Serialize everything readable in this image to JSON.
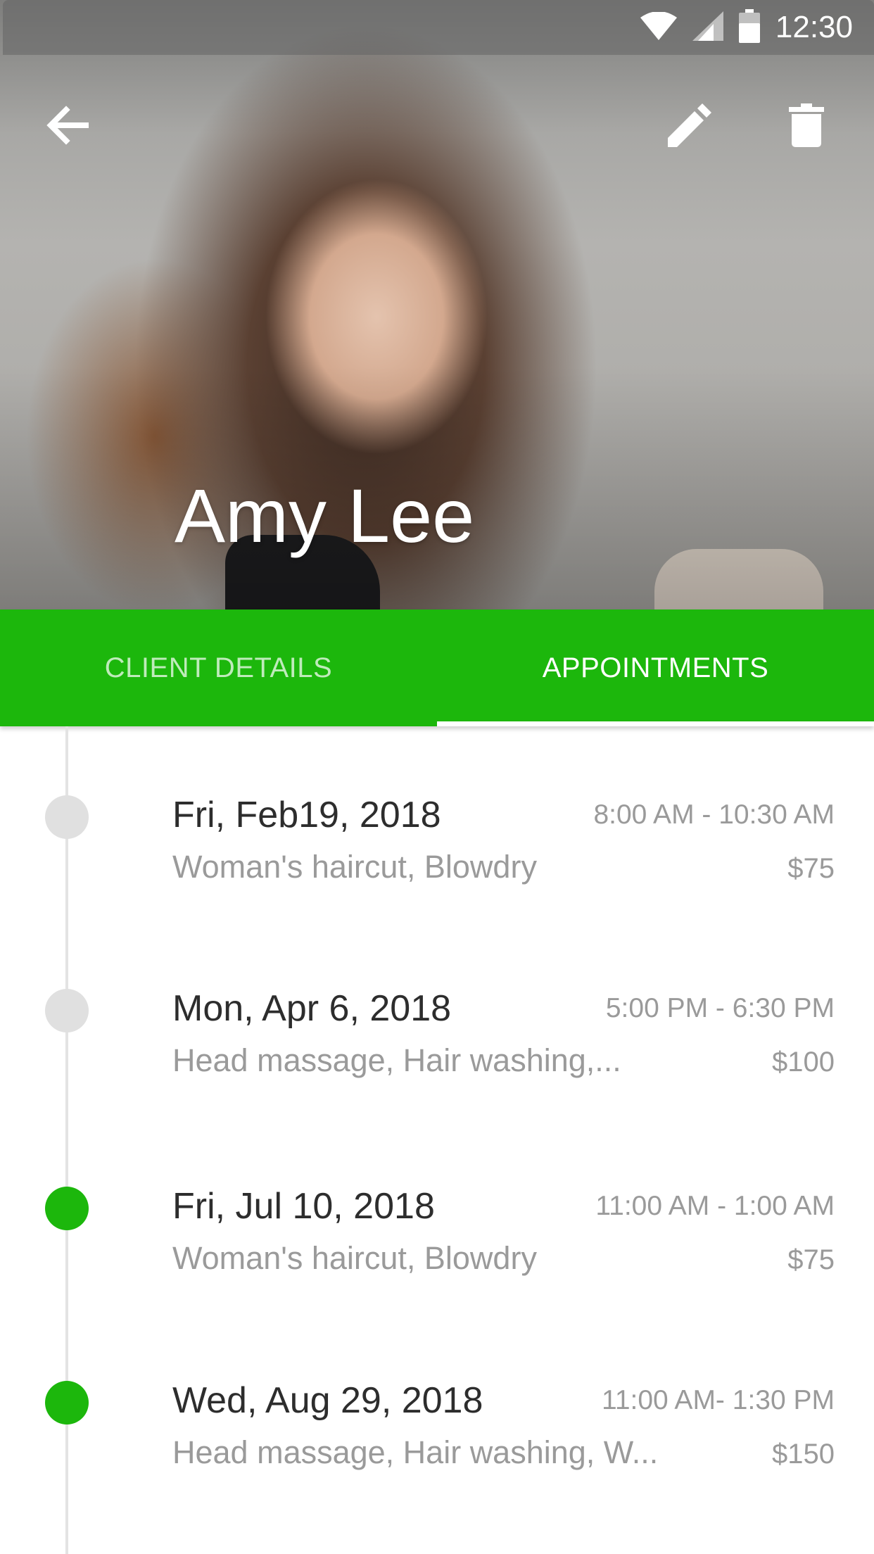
{
  "status_bar": {
    "time": "12:30",
    "icons": [
      "wifi-icon",
      "cell-signal-icon",
      "battery-icon"
    ]
  },
  "toolbar": {
    "back_icon": "arrow-left-icon",
    "edit_icon": "pencil-icon",
    "delete_icon": "trash-icon"
  },
  "client": {
    "name": "Amy Lee"
  },
  "tabs": [
    {
      "label": "CLIENT DETAILS",
      "active": false
    },
    {
      "label": "APPOINTMENTS",
      "active": true
    }
  ],
  "colors": {
    "accent": "#1cb70c",
    "past_dot": "#e0e0e0",
    "primary_text": "#2d2d2d",
    "secondary_text": "#9a9a9a"
  },
  "appointments": [
    {
      "date": "Fri, Feb19, 2018",
      "time": "8:00 AM - 10:30 AM",
      "services": "Woman's haircut, Blowdry",
      "price": "$75",
      "status": "past"
    },
    {
      "date": "Mon, Apr 6, 2018",
      "time": "5:00 PM - 6:30 PM",
      "services": "Head massage, Hair washing,...",
      "price": "$100",
      "status": "past"
    },
    {
      "date": "Fri, Jul 10, 2018",
      "time": "11:00 AM - 1:00 AM",
      "services": "Woman's haircut, Blowdry",
      "price": "$75",
      "status": "upcoming"
    },
    {
      "date": "Wed, Aug 29, 2018",
      "time": "11:00 AM- 1:30 PM",
      "services": "Head massage, Hair washing, W...",
      "price": "$150",
      "status": "upcoming"
    }
  ]
}
